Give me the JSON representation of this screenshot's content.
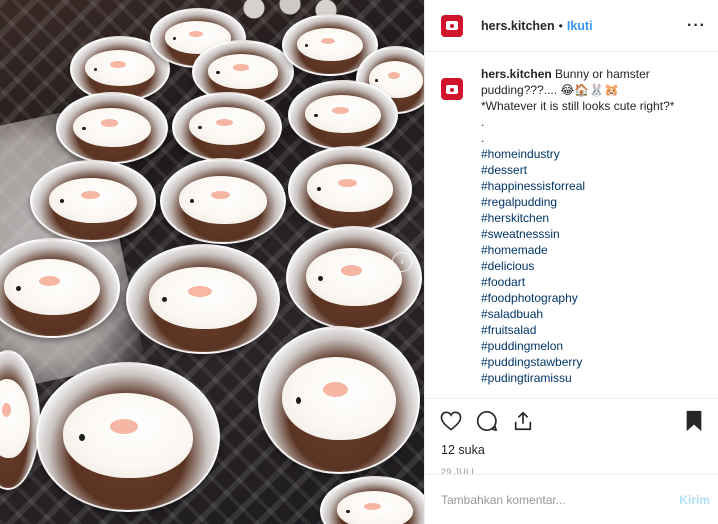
{
  "post": {
    "username": "hers.kitchen",
    "separator": "•",
    "follow_label": "Ikuti",
    "more_icon": "more-icon"
  },
  "caption": {
    "username": "hers.kitchen",
    "text": "Bunny or hamster pudding???.... 😂🏠🐰🐹",
    "line2": "*Whatever it is still looks cute right?*",
    "dot1": ".",
    "dot2": ".",
    "hashtags": [
      "#homeindustry",
      "#dessert",
      "#happinessisforreal",
      "#regalpudding",
      "#herskitchen",
      "#sweatnesssin",
      "#homemade",
      "#delicious",
      "#foodart",
      "#foodphotography",
      "#saladbuah",
      "#fruitsalad",
      "#puddingmelon",
      "#puddingstawberry",
      "#pudingtiramissu"
    ]
  },
  "actions": {
    "like_icon": "heart-icon",
    "comment_icon": "comment-icon",
    "share_icon": "share-icon",
    "save_icon": "bookmark-icon"
  },
  "likes": "12 suka",
  "date": "29 JULI",
  "comment_box": {
    "placeholder": "Tambahkan komentar...",
    "post_label": "Kirim"
  },
  "colors": {
    "brand": "#d0142b",
    "link": "#3897f0",
    "hashtag": "#003569",
    "post_disabled": "#b2dffc"
  }
}
